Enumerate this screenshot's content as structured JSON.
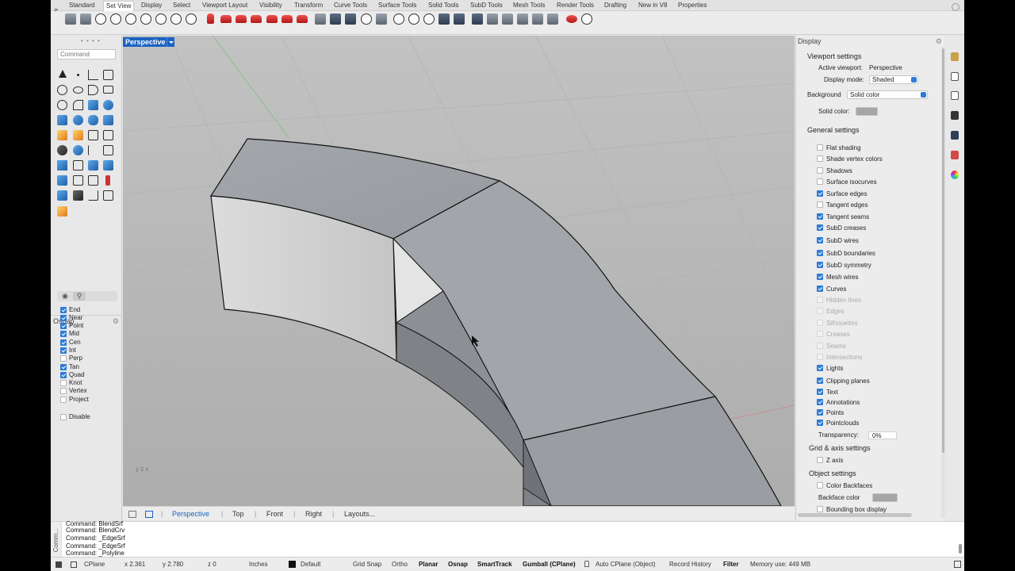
{
  "toolbar": {
    "vertical_label": "Set View",
    "tabs": [
      "Standard",
      "Set View",
      "Display",
      "Select",
      "Viewport Layout",
      "Visibility",
      "Transform",
      "Curve Tools",
      "Surface Tools",
      "Solid Tools",
      "SubD Tools",
      "Mesh Tools",
      "Render Tools",
      "Drafting",
      "New in V8",
      "Properties"
    ],
    "active_tab": "Set View"
  },
  "command": {
    "placeholder": "Command"
  },
  "osnap": {
    "title": "Osnap",
    "items": [
      {
        "label": "End",
        "checked": true
      },
      {
        "label": "Near",
        "checked": true
      },
      {
        "label": "Point",
        "checked": true
      },
      {
        "label": "Mid",
        "checked": true
      },
      {
        "label": "Cen",
        "checked": true
      },
      {
        "label": "Int",
        "checked": true
      },
      {
        "label": "Perp",
        "checked": false
      },
      {
        "label": "Tan",
        "checked": true
      },
      {
        "label": "Quad",
        "checked": true
      },
      {
        "label": "Knot",
        "checked": false
      },
      {
        "label": "Vertex",
        "checked": false
      },
      {
        "label": "Project",
        "checked": false
      }
    ],
    "disable_label": "Disable"
  },
  "viewport": {
    "title": "Perspective",
    "tabs": [
      "Perspective",
      "Top",
      "Front",
      "Right",
      "Layouts..."
    ],
    "active_tab": "Perspective",
    "axis_label": "y z x"
  },
  "display_panel": {
    "title": "Display",
    "viewport_settings": {
      "heading": "Viewport settings",
      "active_viewport_label": "Active viewport:",
      "active_viewport_value": "Perspective",
      "display_mode_label": "Display mode:",
      "display_mode_value": "Shaded",
      "background_label": "Background",
      "background_value": "Solid color",
      "solid_color_label": "Solid color:"
    },
    "general_settings": {
      "heading": "General settings",
      "items": [
        {
          "label": "Flat shading",
          "checked": false,
          "enabled": true
        },
        {
          "label": "Shade vertex colors",
          "checked": false,
          "enabled": true
        },
        {
          "label": "Shadows",
          "checked": false,
          "enabled": true
        },
        {
          "label": "Surface isocurves",
          "checked": false,
          "enabled": true
        },
        {
          "label": "Surface edges",
          "checked": true,
          "enabled": true
        },
        {
          "label": "Tangent edges",
          "checked": false,
          "enabled": true
        },
        {
          "label": "Tangent seams",
          "checked": true,
          "enabled": true
        },
        {
          "label": "SubD creases",
          "checked": true,
          "enabled": true
        },
        {
          "label": "SubD wires",
          "checked": true,
          "enabled": true
        },
        {
          "label": "SubD boundaries",
          "checked": true,
          "enabled": true
        },
        {
          "label": "SubD symmetry",
          "checked": true,
          "enabled": true
        },
        {
          "label": "Mesh wires",
          "checked": true,
          "enabled": true
        },
        {
          "label": "Curves",
          "checked": true,
          "enabled": true
        },
        {
          "label": "Hidden lines",
          "checked": false,
          "enabled": false
        },
        {
          "label": "Edges",
          "checked": false,
          "enabled": false
        },
        {
          "label": "Silhouettes",
          "checked": false,
          "enabled": false
        },
        {
          "label": "Creases",
          "checked": false,
          "enabled": false
        },
        {
          "label": "Seams",
          "checked": false,
          "enabled": false
        },
        {
          "label": "Intersections",
          "checked": false,
          "enabled": false
        },
        {
          "label": "Lights",
          "checked": true,
          "enabled": true
        },
        {
          "label": "Clipping planes",
          "checked": true,
          "enabled": true
        },
        {
          "label": "Text",
          "checked": true,
          "enabled": true
        },
        {
          "label": "Annotations",
          "checked": true,
          "enabled": true
        },
        {
          "label": "Points",
          "checked": true,
          "enabled": true
        },
        {
          "label": "Pointclouds",
          "checked": true,
          "enabled": true
        }
      ],
      "transparency_label": "Transparency:",
      "transparency_value": "0%"
    },
    "grid_axis": {
      "heading": "Grid & axis settings",
      "z_axis_label": "Z axis"
    },
    "object_settings": {
      "heading": "Object settings",
      "color_backfaces_label": "Color Backfaces",
      "backface_color_label": "Backface color",
      "bounding_box_label": "Bounding box display"
    }
  },
  "command_history": {
    "side_label": "Comm...",
    "lines": [
      "Command: BlendSrf",
      "Command: BlendCrv",
      "Command: _EdgeSrf",
      "Command: _EdgeSrf",
      "Command: _Polyline"
    ]
  },
  "status_bar": {
    "cplane": "CPlane",
    "x": "x 2.361",
    "y": "y 2.780",
    "z": "z 0",
    "units": "Inches",
    "layer": "Default",
    "grid_snap": "Grid Snap",
    "ortho": "Ortho",
    "planar": "Planar",
    "osnap": "Osnap",
    "smarttrack": "SmartTrack",
    "gumball": "Gumball (CPlane)",
    "auto_cplane": "Auto CPlane (Object)",
    "record_history": "Record History",
    "filter": "Filter",
    "memory": "Memory use: 449 MB"
  },
  "colors": {
    "accent": "#1a63c2",
    "checkbox": "#2e7bd6",
    "viewport_bg": "#b8b8b8",
    "model_surface": "#9da1a6"
  }
}
